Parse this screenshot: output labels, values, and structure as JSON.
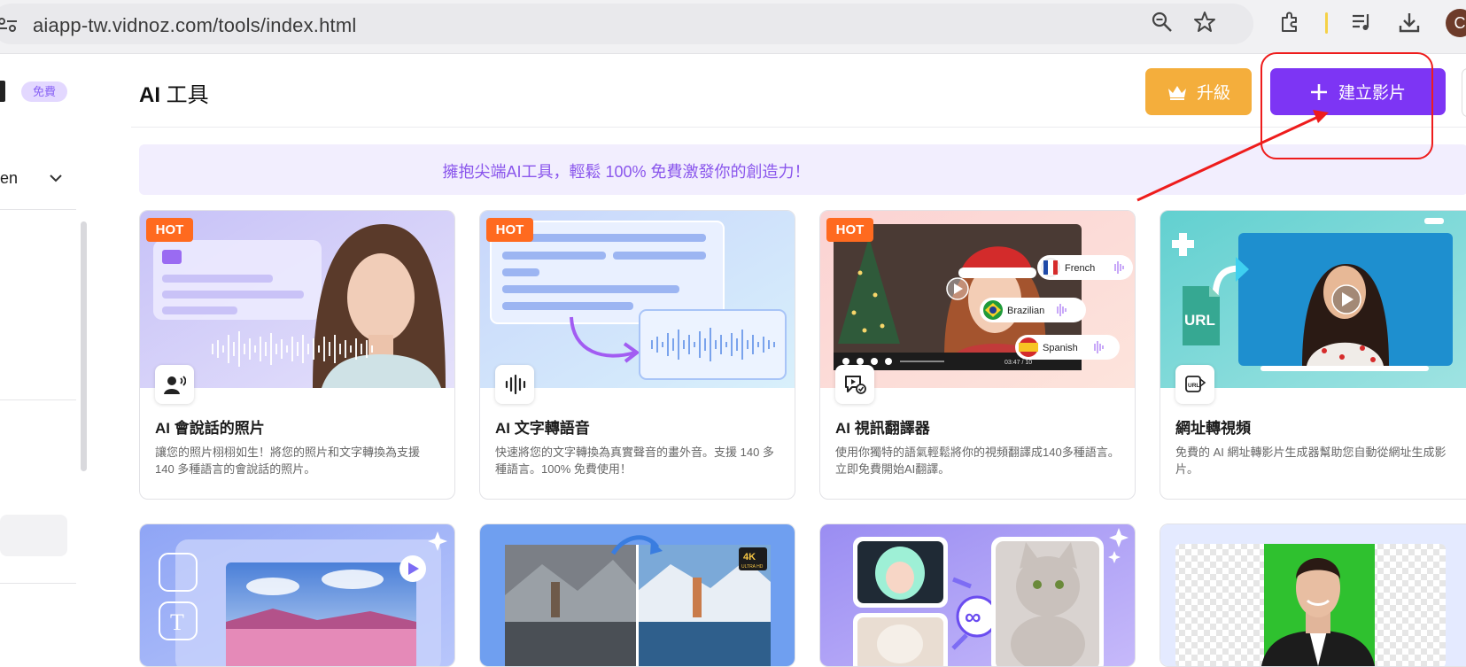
{
  "browser": {
    "url": "aiapp-tw.vidnoz.com/tools/index.html",
    "profile_initial": "C"
  },
  "sidebar": {
    "badge": "免費",
    "language": "en"
  },
  "header": {
    "title_bold": "AI",
    "title_rest": " 工具",
    "upgrade_label": "升級",
    "create_label": "建立影片"
  },
  "banner": {
    "text": "擁抱尖端AI工具，輕鬆 100% 免費激發你的創造力！"
  },
  "cards": [
    {
      "badge": "HOT",
      "title": "AI 會說話的照片",
      "description": "讓您的照片栩栩如生！將您的照片和文字轉換為支援 140 多種語言的會說話的照片。"
    },
    {
      "badge": "HOT",
      "title": "AI 文字轉語音",
      "description": "快速將您的文字轉換為真實聲音的畫外音。支援 140 多種語言。100% 免費使用！"
    },
    {
      "badge": "HOT",
      "title": "AI 視訊翻譯器",
      "description": "使用你獨特的語氣輕鬆將你的視頻翻譯成140多種語言。立即免費開始AI翻譯。",
      "languages": [
        "French",
        "Brazilian",
        "Spanish"
      ],
      "timecode": "03:47 / 10"
    },
    {
      "badge": "",
      "title": "網址轉視頻",
      "description": "免費的 AI 網址轉影片生成器幫助您自動從網址生成影片。",
      "url_label": "URL"
    }
  ],
  "row2": {
    "resolution_badge": "4K",
    "resolution_sub": "ULTRA HD"
  },
  "colors": {
    "accent_purple": "#7d35f4",
    "upgrade_orange": "#f4ae3c",
    "hot_orange": "#ff6a1f",
    "annotation_red": "#ee1c1c"
  }
}
